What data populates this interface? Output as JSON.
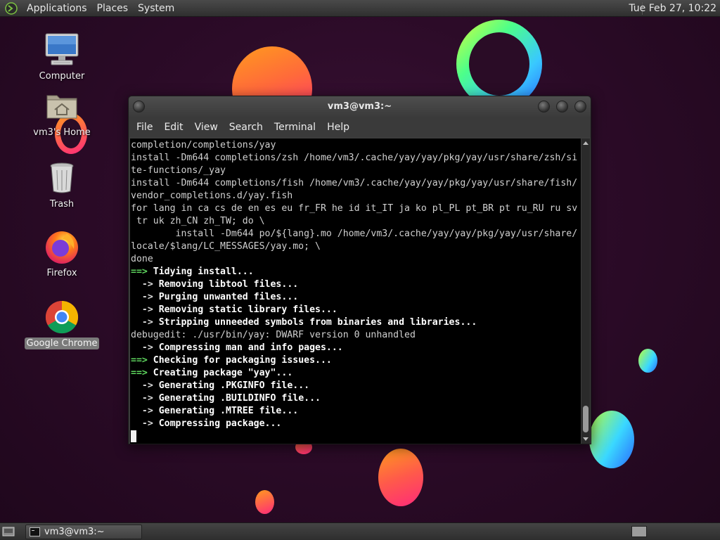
{
  "top_panel": {
    "menu": [
      "Applications",
      "Places",
      "System"
    ],
    "clock": "Tue Feb 27, 10:22"
  },
  "desktop": {
    "icons": [
      {
        "label": "Computer",
        "icon": "computer-icon"
      },
      {
        "label": "vm3's Home",
        "icon": "home-folder-icon"
      },
      {
        "label": "Trash",
        "icon": "trash-icon"
      },
      {
        "label": "Firefox",
        "icon": "firefox-icon"
      },
      {
        "label": "Google Chrome",
        "icon": "chrome-icon",
        "selected": true
      }
    ]
  },
  "window": {
    "title": "vm3@vm3:~",
    "menu": [
      "File",
      "Edit",
      "View",
      "Search",
      "Terminal",
      "Help"
    ],
    "terminal_lines": [
      {
        "style": "n",
        "text": "completion/completions/yay"
      },
      {
        "style": "n",
        "text": "install -Dm644 completions/zsh /home/vm3/.cache/yay/yay/pkg/yay/usr/share/zsh/si"
      },
      {
        "style": "n",
        "text": "te-functions/_yay"
      },
      {
        "style": "n",
        "text": "install -Dm644 completions/fish /home/vm3/.cache/yay/yay/pkg/yay/usr/share/fish/"
      },
      {
        "style": "n",
        "text": "vendor_completions.d/yay.fish"
      },
      {
        "style": "n",
        "text": "for lang in ca cs de en es eu fr_FR he id it_IT ja ko pl_PL pt_BR pt ru_RU ru sv"
      },
      {
        "style": "n",
        "text": " tr uk zh_CN zh_TW; do \\"
      },
      {
        "style": "n",
        "text": "        install -Dm644 po/${lang}.mo /home/vm3/.cache/yay/yay/pkg/yay/usr/share/"
      },
      {
        "style": "n",
        "text": "locale/$lang/LC_MESSAGES/yay.mo; \\"
      },
      {
        "style": "n",
        "text": "done"
      },
      {
        "style": "g",
        "prefix": "==>",
        "text": " Tidying install..."
      },
      {
        "style": "b",
        "prefix": "  ->",
        "text": " Removing libtool files..."
      },
      {
        "style": "b",
        "prefix": "  ->",
        "text": " Purging unwanted files..."
      },
      {
        "style": "b",
        "prefix": "  ->",
        "text": " Removing static library files..."
      },
      {
        "style": "b",
        "prefix": "  ->",
        "text": " Stripping unneeded symbols from binaries and libraries..."
      },
      {
        "style": "n",
        "text": "debugedit: ./usr/bin/yay: DWARF version 0 unhandled"
      },
      {
        "style": "b",
        "prefix": "  ->",
        "text": " Compressing man and info pages..."
      },
      {
        "style": "g",
        "prefix": "==>",
        "text": " Checking for packaging issues..."
      },
      {
        "style": "g",
        "prefix": "==>",
        "text": " Creating package \"yay\"..."
      },
      {
        "style": "b",
        "prefix": "  ->",
        "text": " Generating .PKGINFO file..."
      },
      {
        "style": "b",
        "prefix": "  ->",
        "text": " Generating .BUILDINFO file..."
      },
      {
        "style": "b",
        "prefix": "  ->",
        "text": " Generating .MTREE file..."
      },
      {
        "style": "b",
        "prefix": "  ->",
        "text": " Compressing package..."
      }
    ]
  },
  "bottom_panel": {
    "task": "vm3@vm3:~"
  },
  "colors": {
    "prompt_green": "#5fd75f",
    "terminal_bg": "#000000",
    "selection_grey": "#7a7a7a"
  }
}
